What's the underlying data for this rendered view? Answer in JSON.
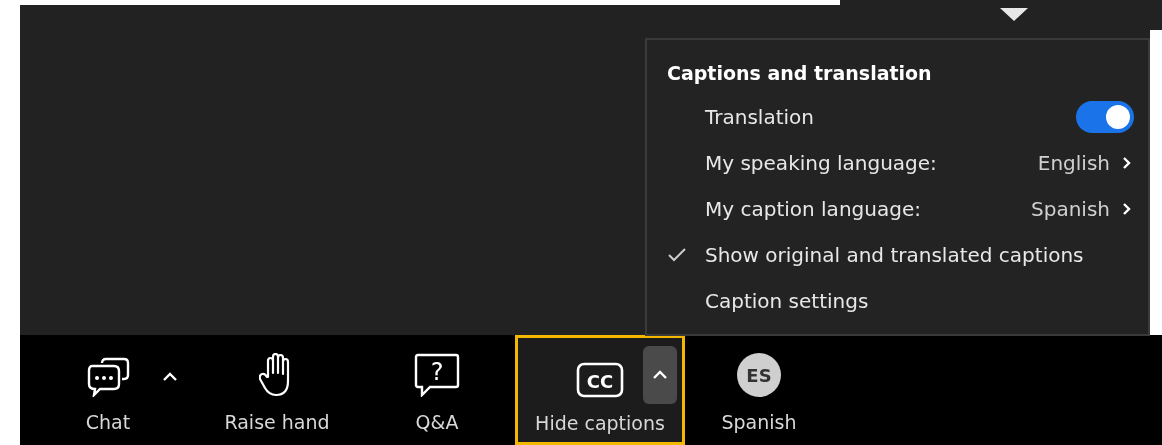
{
  "menu": {
    "title": "Captions and translation",
    "items": [
      {
        "kind": "toggle",
        "label": "Translation",
        "on": true
      },
      {
        "kind": "submenu",
        "label": "My speaking language:",
        "value": "English"
      },
      {
        "kind": "submenu",
        "label": "My caption language:",
        "value": "Spanish"
      },
      {
        "kind": "check",
        "label": "Show original and translated captions",
        "checked": true
      },
      {
        "kind": "plain",
        "label": "Caption settings"
      }
    ]
  },
  "toolbar": [
    {
      "kind": "chat",
      "label": "Chat",
      "has_menu": true,
      "highlighted": false
    },
    {
      "kind": "hand",
      "label": "Raise hand",
      "has_menu": false,
      "highlighted": false
    },
    {
      "kind": "qa",
      "label": "Q&A",
      "icon_text": "?",
      "has_menu": false,
      "highlighted": false
    },
    {
      "kind": "captions",
      "label": "Hide captions",
      "icon_text": "CC",
      "has_menu": true,
      "highlighted": true
    },
    {
      "kind": "avatar",
      "label": "Spanish",
      "initials": "ES",
      "has_menu": false,
      "highlighted": false
    }
  ]
}
